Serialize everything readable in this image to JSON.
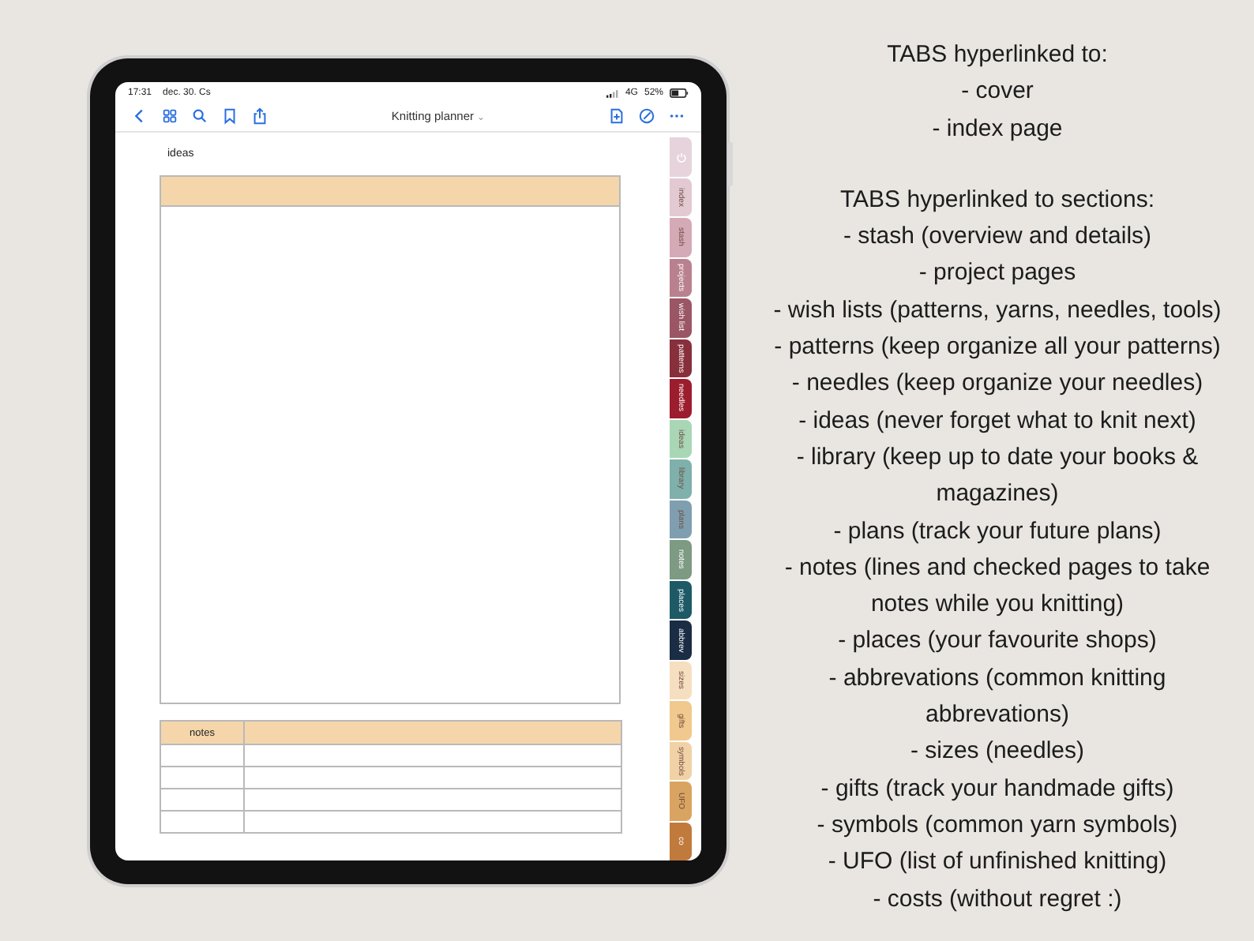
{
  "status_bar": {
    "time": "17:31",
    "date": "dec. 30. Cs",
    "network": "4G",
    "battery": "52%"
  },
  "toolbar": {
    "title": "Knitting planner",
    "caret": "⌄"
  },
  "page": {
    "heading": "ideas",
    "notes_table": {
      "columns": [
        "notes"
      ]
    }
  },
  "tabs": [
    {
      "kind": "icon",
      "color": "#e6d3db"
    },
    {
      "kind": "text",
      "label": "index",
      "color": "#e3c9d2"
    },
    {
      "kind": "text",
      "label": "stash",
      "color": "#d4aab6"
    },
    {
      "kind": "text",
      "label": "projects",
      "color": "#b9818f"
    },
    {
      "kind": "text",
      "label": "wish list",
      "color": "#9a5665"
    },
    {
      "kind": "text",
      "label": "patterns",
      "color": "#87303c"
    },
    {
      "kind": "text",
      "label": "needles",
      "color": "#9c1d2d"
    },
    {
      "kind": "text",
      "label": "ideas",
      "color": "#a9d6b5"
    },
    {
      "kind": "text",
      "label": "library",
      "color": "#7fb0ab"
    },
    {
      "kind": "text",
      "label": "plans",
      "color": "#7f9fb0"
    },
    {
      "kind": "text",
      "label": "notes",
      "color": "#7d9a83"
    },
    {
      "kind": "text",
      "label": "places",
      "color": "#1e5a66"
    },
    {
      "kind": "text",
      "label": "abbrev",
      "color": "#1b2d45"
    },
    {
      "kind": "text",
      "label": "sizes",
      "color": "#f6dfc0"
    },
    {
      "kind": "text",
      "label": "gifts",
      "color": "#f1c98e"
    },
    {
      "kind": "text",
      "label": "symbols",
      "color": "#f0d2a6"
    },
    {
      "kind": "text",
      "label": "UFO",
      "color": "#d9a461"
    },
    {
      "kind": "text",
      "label": "co",
      "color": "#c07a3c"
    }
  ],
  "info": [
    {
      "heading": "TABS hyperlinked to:",
      "items": [
        "- cover",
        "- index page"
      ]
    },
    {
      "heading": "TABS hyperlinked to sections:",
      "items": [
        "- stash (overview and details)",
        "- project pages",
        "- wish lists (patterns, yarns, needles, tools)",
        "- patterns (keep organize all your patterns)",
        "- needles (keep organize your needles)",
        "- ideas (never forget what to knit next)",
        "- library (keep up to date your books & magazines)",
        "- plans (track your future plans)",
        "- notes (lines and checked pages to take notes while you knitting)",
        "- places (your favourite shops)",
        "- abbrevations (common knitting abbrevations)",
        "- sizes (needles)",
        "- gifts (track your handmade gifts)",
        "- symbols (common yarn symbols)",
        "- UFO (list of unfinished knitting)",
        "- costs (without regret :)"
      ]
    }
  ]
}
